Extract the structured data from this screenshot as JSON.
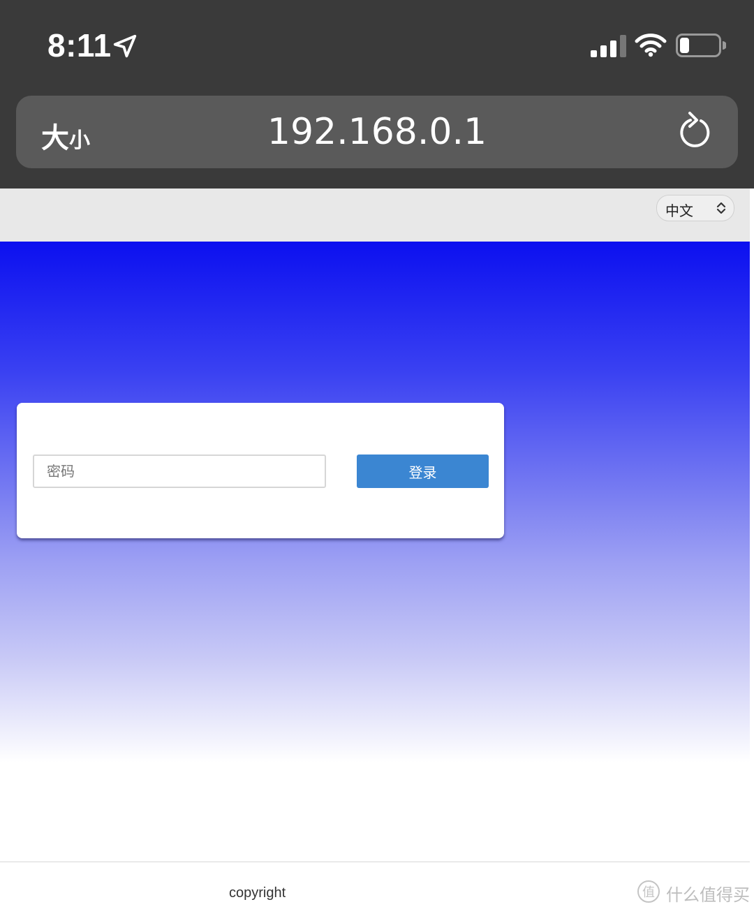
{
  "status_bar": {
    "time": "8:11",
    "location_icon": "location-arrow-icon",
    "signal_icon": "cellular-signal-icon",
    "wifi_icon": "wifi-icon",
    "battery_icon": "battery-icon"
  },
  "address_bar": {
    "text_size_label_big": "大",
    "text_size_label_small": "小",
    "url": "192.168.0.1",
    "reload_icon": "reload-icon"
  },
  "language_selector": {
    "selected": "中文",
    "icon": "chevron-updown-icon"
  },
  "login_form": {
    "password_placeholder": "密码",
    "password_value": "",
    "login_label": "登录",
    "colors": {
      "button": "#3b86d2",
      "hero_top": "#0c10f0"
    }
  },
  "footer": {
    "copyright": "copyright"
  },
  "watermark": {
    "logo_char": "值",
    "text": "什么值得买"
  }
}
